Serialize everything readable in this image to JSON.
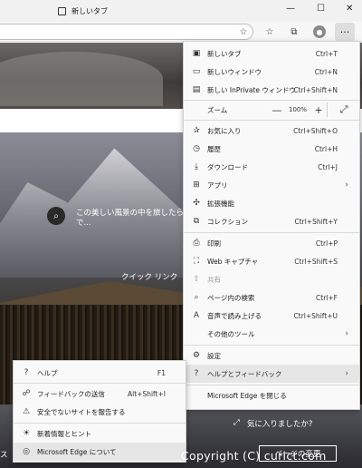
{
  "tab": {
    "title": "新しいタブ"
  },
  "window": {
    "minimize": "—",
    "restore": "☐",
    "close": "✕"
  },
  "toolbar": {
    "more_label": "···"
  },
  "page": {
    "hero_text": "この美しい風景の中を旅したら で...",
    "quick_links": "クイック リンク",
    "like_text": "気に入りましたか?",
    "personalize": "ページの変更",
    "left_edge_text": "ス",
    "watermark": "Copyright (C) curict.com"
  },
  "menu": {
    "items": [
      {
        "label": "新しいタブ",
        "shortcut": "Ctrl+T",
        "icon": "new-tab-icon"
      },
      {
        "label": "新しいウィンドウ",
        "shortcut": "Ctrl+N",
        "icon": "new-window-icon"
      },
      {
        "label": "新しい InPrivate ウィンドウ",
        "shortcut": "Ctrl+Shift+N",
        "icon": "inprivate-icon"
      },
      {
        "label": "お気に入り",
        "shortcut": "Ctrl+Shift+O",
        "icon": "favorites-icon"
      },
      {
        "label": "履歴",
        "shortcut": "Ctrl+H",
        "icon": "history-icon"
      },
      {
        "label": "ダウンロード",
        "shortcut": "Ctrl+J",
        "icon": "download-icon"
      },
      {
        "label": "アプリ",
        "shortcut": "",
        "icon": "apps-icon"
      },
      {
        "label": "拡張機能",
        "shortcut": "",
        "icon": "extensions-icon"
      },
      {
        "label": "コレクション",
        "shortcut": "Ctrl+Shift+Y",
        "icon": "collections-icon"
      },
      {
        "label": "印刷",
        "shortcut": "Ctrl+P",
        "icon": "print-icon"
      },
      {
        "label": "Web キャプチャ",
        "shortcut": "Ctrl+Shift+S",
        "icon": "web-capture-icon"
      },
      {
        "label": "共有",
        "shortcut": "",
        "icon": "share-icon"
      },
      {
        "label": "ページ内の検索",
        "shortcut": "Ctrl+F",
        "icon": "find-icon"
      },
      {
        "label": "音声で読み上げる",
        "shortcut": "Ctrl+Shift+U",
        "icon": "read-aloud-icon"
      },
      {
        "label": "その他のツール",
        "shortcut": "",
        "icon": ""
      },
      {
        "label": "設定",
        "shortcut": "",
        "icon": "settings-icon"
      },
      {
        "label": "ヘルプとフィードバック",
        "shortcut": "",
        "icon": "help-icon"
      },
      {
        "label": "Microsoft Edge を閉じる",
        "shortcut": "",
        "icon": ""
      }
    ],
    "zoom": {
      "label": "ズーム",
      "value": "100%",
      "minus": "—",
      "plus": "+"
    }
  },
  "submenu": {
    "items": [
      {
        "label": "ヘルプ",
        "shortcut": "F1",
        "icon": "help-icon"
      },
      {
        "label": "フィードバックの送信",
        "shortcut": "Alt+Shift+I",
        "icon": "feedback-icon"
      },
      {
        "label": "安全でないサイトを報告する",
        "shortcut": "",
        "icon": "warning-icon"
      },
      {
        "label": "新着情報とヒント",
        "shortcut": "",
        "icon": "lightbulb-icon"
      },
      {
        "label": "Microsoft Edge について",
        "shortcut": "",
        "icon": "edge-logo-icon"
      }
    ]
  }
}
